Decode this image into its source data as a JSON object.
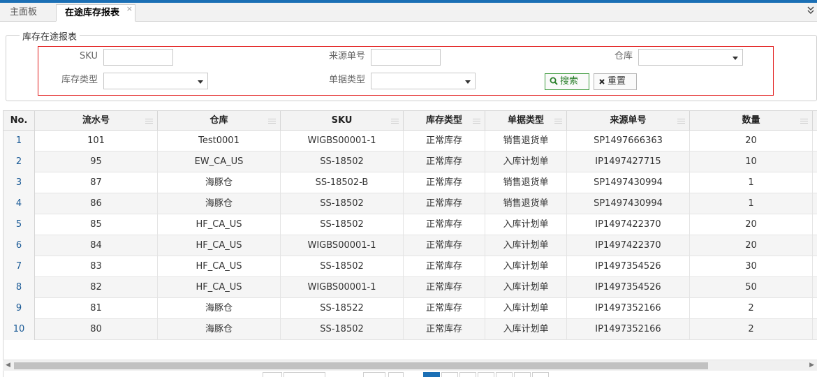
{
  "tabs": {
    "home_label": "主面板",
    "active_label": "在途库存报表",
    "close_glyph": "×",
    "menu_glyph": "≫"
  },
  "filter": {
    "legend": "库存在途报表",
    "sku_label": "SKU",
    "source_no_label": "来源单号",
    "warehouse_label": "仓库",
    "stock_type_label": "库存类型",
    "doc_type_label": "单据类型",
    "sku_value": "",
    "source_no_value": "",
    "warehouse_value": "",
    "stock_type_value": "",
    "doc_type_value": "",
    "search_label": "搜索",
    "reset_label": "重置"
  },
  "grid": {
    "columns": [
      "No.",
      "流水号",
      "仓库",
      "SKU",
      "库存类型",
      "单据类型",
      "来源单号",
      "数量"
    ],
    "rows": [
      [
        "1",
        "101",
        "Test0001",
        "WIGBS00001-1",
        "正常库存",
        "销售退货单",
        "SP1497666363",
        "20"
      ],
      [
        "2",
        "95",
        "EW_CA_US",
        "SS-18502",
        "正常库存",
        "入库计划单",
        "IP1497427715",
        "10"
      ],
      [
        "3",
        "87",
        "海豚仓",
        "SS-18502-B",
        "正常库存",
        "销售退货单",
        "SP1497430994",
        "1"
      ],
      [
        "4",
        "86",
        "海豚仓",
        "SS-18502",
        "正常库存",
        "销售退货单",
        "SP1497430994",
        "1"
      ],
      [
        "5",
        "85",
        "HF_CA_US",
        "SS-18502",
        "正常库存",
        "入库计划单",
        "IP1497422370",
        "20"
      ],
      [
        "6",
        "84",
        "HF_CA_US",
        "WIGBS00001-1",
        "正常库存",
        "入库计划单",
        "IP1497422370",
        "20"
      ],
      [
        "7",
        "83",
        "HF_CA_US",
        "SS-18502",
        "正常库存",
        "入库计划单",
        "IP1497354526",
        "30"
      ],
      [
        "8",
        "82",
        "HF_CA_US",
        "WIGBS00001-1",
        "正常库存",
        "入库计划单",
        "IP1497354526",
        "50"
      ],
      [
        "9",
        "81",
        "海豚仓",
        "SS-18522",
        "正常库存",
        "入库计划单",
        "IP1497352166",
        "2"
      ],
      [
        "10",
        "80",
        "海豚仓",
        "SS-18502",
        "正常库存",
        "入库计划单",
        "IP1497352166",
        "2"
      ]
    ]
  },
  "colors": {
    "accent": "#1b6fb5",
    "highlight": "#e21b1b",
    "search_green": "#2a7f2a"
  }
}
